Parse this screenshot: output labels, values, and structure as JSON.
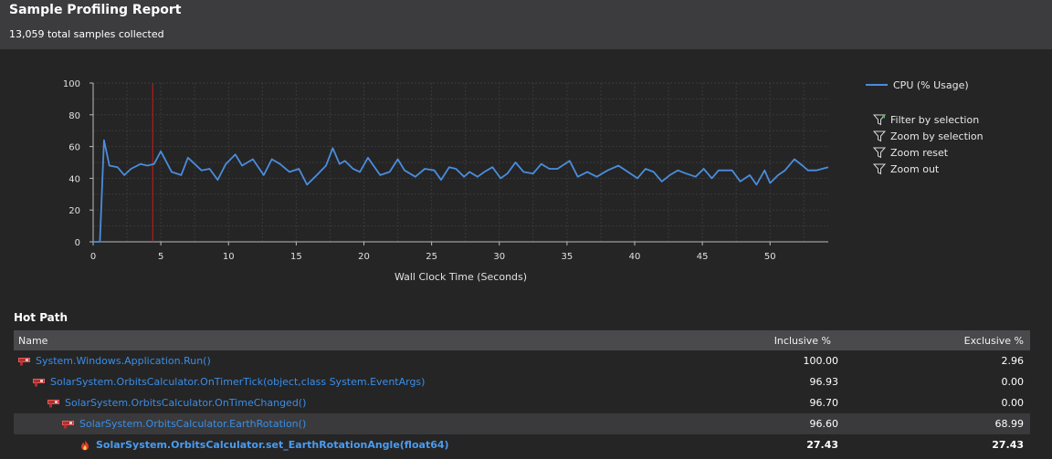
{
  "header": {
    "title": "Sample Profiling Report",
    "subtitle": "13,059 total samples collected"
  },
  "legend": {
    "label": "CPU (% Usage)"
  },
  "actions": [
    {
      "label": "Filter by selection",
      "icon": "filter-selection-icon"
    },
    {
      "label": "Zoom by selection",
      "icon": "zoom-selection-icon"
    },
    {
      "label": "Zoom reset",
      "icon": "zoom-reset-icon"
    },
    {
      "label": "Zoom out",
      "icon": "zoom-out-icon"
    }
  ],
  "chart_data": {
    "type": "line",
    "xlabel": "Wall Clock Time (Seconds)",
    "ylabel": "",
    "xlim": [
      0,
      54.3
    ],
    "ylim": [
      0,
      100
    ],
    "x_ticks": [
      0,
      5,
      10,
      15,
      20,
      25,
      30,
      35,
      40,
      45,
      50
    ],
    "y_ticks": [
      0,
      20,
      40,
      60,
      80,
      100
    ],
    "grid": true,
    "legend_position": "right",
    "cursor_x": 4.4,
    "colors": {
      "line": "#4a8ddc",
      "cursor": "#d01818",
      "grid": "#3a3a3c",
      "axis": "#bbbbbb"
    },
    "series": [
      {
        "name": "CPU (% Usage)",
        "x": [
          0.0,
          0.2,
          0.5,
          0.8,
          1.2,
          1.8,
          2.3,
          2.8,
          3.5,
          4.0,
          4.5,
          5.0,
          5.8,
          6.5,
          7.0,
          7.5,
          8.0,
          8.6,
          9.2,
          9.8,
          10.5,
          11.0,
          11.8,
          12.6,
          13.2,
          13.8,
          14.5,
          15.2,
          15.8,
          16.4,
          17.2,
          17.7,
          18.2,
          18.6,
          19.2,
          19.7,
          20.3,
          21.2,
          21.9,
          22.5,
          23.0,
          23.8,
          24.5,
          25.2,
          25.7,
          26.3,
          26.8,
          27.4,
          27.8,
          28.4,
          28.9,
          29.5,
          30.1,
          30.6,
          31.2,
          31.8,
          32.5,
          33.1,
          33.7,
          34.3,
          35.2,
          35.8,
          36.5,
          37.2,
          38.0,
          38.8,
          39.5,
          40.2,
          40.8,
          41.4,
          42.0,
          42.6,
          43.2,
          43.8,
          44.5,
          45.1,
          45.7,
          46.2,
          46.7,
          47.2,
          47.8,
          48.5,
          49.0,
          49.6,
          50.0,
          50.6,
          51.1,
          51.8,
          52.4,
          52.8,
          53.4,
          54.3
        ],
        "values": [
          0,
          0,
          0,
          64,
          48,
          47,
          42,
          46,
          49,
          48,
          49,
          57,
          44,
          42,
          53,
          49,
          45,
          46,
          39,
          49,
          55,
          48,
          52,
          42,
          52,
          49,
          44,
          46,
          36,
          41,
          48,
          59,
          49,
          51,
          46,
          44,
          53,
          42,
          44,
          52,
          45,
          41,
          46,
          45,
          39,
          47,
          46,
          41,
          44,
          41,
          44,
          47,
          40,
          43,
          50,
          44,
          43,
          49,
          46,
          46,
          51,
          41,
          44,
          41,
          45,
          48,
          44,
          40,
          46,
          44,
          38,
          42,
          45,
          43,
          41,
          46,
          40,
          45,
          45,
          45,
          38,
          42,
          36,
          45,
          37,
          42,
          45,
          52,
          48,
          45,
          45,
          47
        ]
      }
    ]
  },
  "hot_path": {
    "title": "Hot Path",
    "columns": {
      "name": "Name",
      "inclusive": "Inclusive %",
      "exclusive": "Exclusive %"
    },
    "rows": [
      {
        "name": "System.Windows.Application.Run()",
        "inclusive": "100.00",
        "exclusive": "2.96",
        "level": 0
      },
      {
        "name": "SolarSystem.OrbitsCalculator.OnTimerTick(object,class System.EventArgs)",
        "inclusive": "96.93",
        "exclusive": "0.00",
        "level": 1
      },
      {
        "name": "SolarSystem.OrbitsCalculator.OnTimeChanged()",
        "inclusive": "96.70",
        "exclusive": "0.00",
        "level": 2
      },
      {
        "name": "SolarSystem.OrbitsCalculator.EarthRotation()",
        "inclusive": "96.60",
        "exclusive": "68.99",
        "level": 3,
        "selected": true
      },
      {
        "name": "SolarSystem.OrbitsCalculator.set_EarthRotationAngle(float64)",
        "inclusive": "27.43",
        "exclusive": "27.43",
        "level": 4,
        "hot": true
      }
    ]
  }
}
